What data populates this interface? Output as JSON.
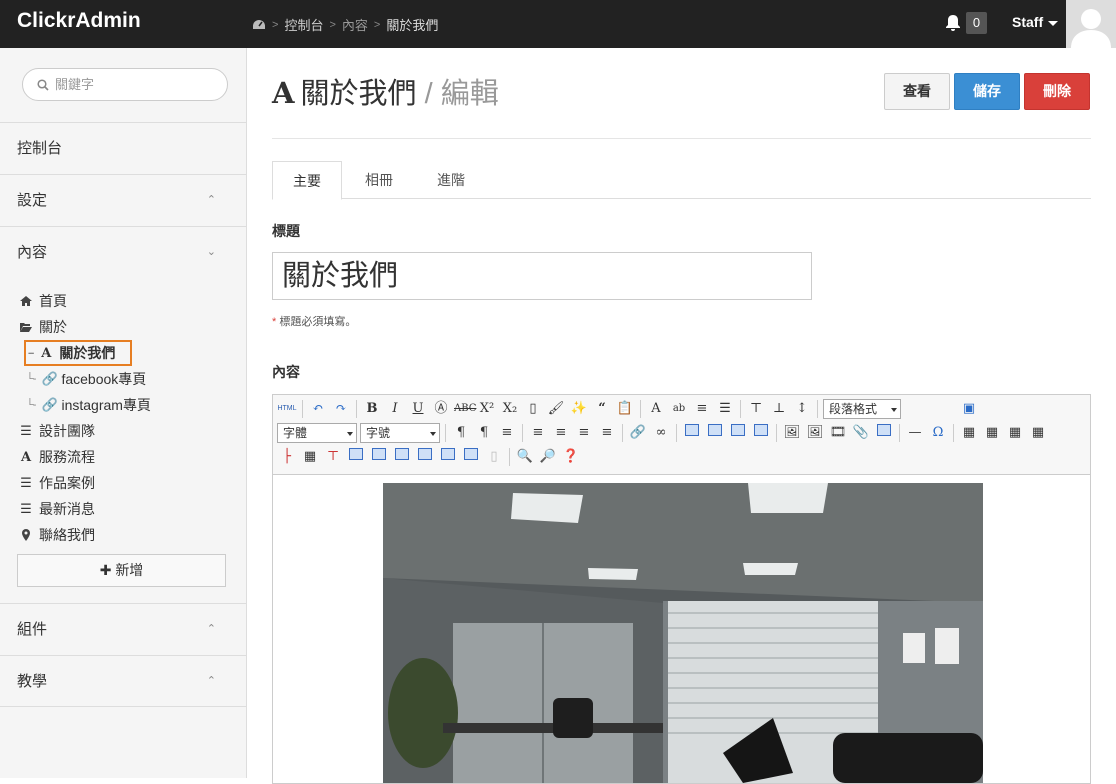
{
  "topbar": {
    "brand": "ClickrAdmin",
    "breadcrumbs": [
      "控制台",
      "內容",
      "關於我們"
    ],
    "notifications": "0",
    "user": "Staff"
  },
  "sidebar": {
    "search_placeholder": "關鍵字",
    "sections": {
      "dashboard": "控制台",
      "settings": "設定",
      "content": "內容",
      "components": "組件",
      "tutorial": "教學"
    },
    "tree": [
      {
        "label": "首頁",
        "icon": "home-icon"
      },
      {
        "label": "關於",
        "icon": "folder-open-icon"
      },
      {
        "label": "關於我們",
        "icon": "font-icon"
      },
      {
        "label": "facebook專頁",
        "icon": "link-icon"
      },
      {
        "label": "instagram專頁",
        "icon": "link-icon"
      },
      {
        "label": "設計團隊",
        "icon": "list-icon"
      },
      {
        "label": "服務流程",
        "icon": "font-icon"
      },
      {
        "label": "作品案例",
        "icon": "list-icon"
      },
      {
        "label": "最新消息",
        "icon": "list-icon"
      },
      {
        "label": "聯絡我們",
        "icon": "map-marker-icon"
      }
    ],
    "add_label": "新增"
  },
  "main": {
    "title": "關於我們",
    "title_suffix": "編輯",
    "buttons": {
      "view": "查看",
      "save": "儲存",
      "delete": "刪除"
    },
    "tabs": [
      "主要",
      "相冊",
      "進階"
    ],
    "title_label": "標題",
    "title_value": "關於我們",
    "title_help": "標題必須填寫。",
    "content_label": "內容"
  },
  "editor": {
    "format_select": "段落格式",
    "font_select": "字體",
    "size_select": "字號",
    "html_label": "HTML"
  },
  "colors": {
    "save": "#3b8fd4",
    "delete": "#d9403a",
    "highlight": "#e67e22",
    "topbar": "#222222"
  }
}
